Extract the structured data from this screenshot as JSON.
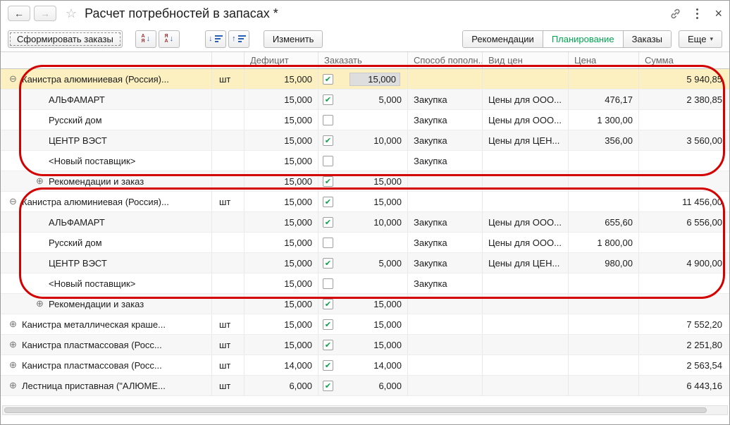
{
  "window": {
    "title": "Расчет потребностей в запасах *"
  },
  "icons": {
    "back": "←",
    "forward": "→",
    "favorite": "☆",
    "menu": "kebab-dots",
    "close": "×",
    "more_arrow": "▾",
    "collapsed": "⊕",
    "expanded": "⊖",
    "check": "✔",
    "sort_arrow_down": "↓",
    "sort_arrow_up": "↑"
  },
  "toolbar": {
    "create_orders": "Сформировать заказы",
    "edit": "Изменить",
    "views": [
      "Рекомендации",
      "Планирование",
      "Заказы"
    ],
    "active_view": "Планирование",
    "more": "Еще"
  },
  "colors": {
    "active_view_green": "#00a651",
    "selected_row_yellow": "#fcf0c0",
    "annotation_red": "#d40000",
    "checkbox_green": "#0ca04a"
  },
  "table": {
    "headers": [
      "",
      "",
      "Дефицит",
      "Заказать",
      "Способ пополн...",
      "Вид цен",
      "Цена",
      "Сумма"
    ],
    "rows": [
      {
        "name": "Канистра алюминиевая (Россия)...",
        "unit": "шт",
        "deficit": "15,000",
        "checked": true,
        "order": "15,000",
        "method": "",
        "price_type": "",
        "price": "",
        "sum": "5 940,85",
        "level": 0,
        "expand": "minus",
        "selected": true
      },
      {
        "name": "АЛЬФАМАРТ",
        "unit": "",
        "deficit": "15,000",
        "checked": true,
        "order": "5,000",
        "method": "Закупка",
        "price_type": "Цены для ООО...",
        "price": "476,17",
        "sum": "2 380,85",
        "level": 1,
        "expand": ""
      },
      {
        "name": "Русский дом",
        "unit": "",
        "deficit": "15,000",
        "checked": false,
        "order": "",
        "method": "Закупка",
        "price_type": "Цены для ООО...",
        "price": "1 300,00",
        "sum": "",
        "level": 1,
        "expand": ""
      },
      {
        "name": "ЦЕНТР ВЭСТ",
        "unit": "",
        "deficit": "15,000",
        "checked": true,
        "order": "10,000",
        "method": "Закупка",
        "price_type": "Цены для ЦЕН...",
        "price": "356,00",
        "sum": "3 560,00",
        "level": 1,
        "expand": ""
      },
      {
        "name": "<Новый поставщик>",
        "unit": "",
        "deficit": "15,000",
        "checked": false,
        "order": "",
        "method": "Закупка",
        "price_type": "",
        "price": "",
        "sum": "",
        "level": 1,
        "expand": ""
      },
      {
        "name": "Рекомендации и заказ",
        "unit": "",
        "deficit": "15,000",
        "checked": true,
        "order": "15,000",
        "method": "",
        "price_type": "",
        "price": "",
        "sum": "",
        "level": 1,
        "expand": "plus"
      },
      {
        "name": "Канистра алюминиевая (Россия)...",
        "unit": "шт",
        "deficit": "15,000",
        "checked": true,
        "order": "15,000",
        "method": "",
        "price_type": "",
        "price": "",
        "sum": "11 456,00",
        "level": 0,
        "expand": "minus"
      },
      {
        "name": "АЛЬФАМАРТ",
        "unit": "",
        "deficit": "15,000",
        "checked": true,
        "order": "10,000",
        "method": "Закупка",
        "price_type": "Цены для ООО...",
        "price": "655,60",
        "sum": "6 556,00",
        "level": 1,
        "expand": ""
      },
      {
        "name": "Русский дом",
        "unit": "",
        "deficit": "15,000",
        "checked": false,
        "order": "",
        "method": "Закупка",
        "price_type": "Цены для ООО...",
        "price": "1 800,00",
        "sum": "",
        "level": 1,
        "expand": ""
      },
      {
        "name": "ЦЕНТР ВЭСТ",
        "unit": "",
        "deficit": "15,000",
        "checked": true,
        "order": "5,000",
        "method": "Закупка",
        "price_type": "Цены для ЦЕН...",
        "price": "980,00",
        "sum": "4 900,00",
        "level": 1,
        "expand": ""
      },
      {
        "name": "<Новый поставщик>",
        "unit": "",
        "deficit": "15,000",
        "checked": false,
        "order": "",
        "method": "Закупка",
        "price_type": "",
        "price": "",
        "sum": "",
        "level": 1,
        "expand": ""
      },
      {
        "name": "Рекомендации и заказ",
        "unit": "",
        "deficit": "15,000",
        "checked": true,
        "order": "15,000",
        "method": "",
        "price_type": "",
        "price": "",
        "sum": "",
        "level": 1,
        "expand": "plus"
      },
      {
        "name": "Канистра металлическая краше...",
        "unit": "шт",
        "deficit": "15,000",
        "checked": true,
        "order": "15,000",
        "method": "",
        "price_type": "",
        "price": "",
        "sum": "7 552,20",
        "level": 0,
        "expand": "plus"
      },
      {
        "name": "Канистра пластмассовая (Росс...",
        "unit": "шт",
        "deficit": "15,000",
        "checked": true,
        "order": "15,000",
        "method": "",
        "price_type": "",
        "price": "",
        "sum": "2 251,80",
        "level": 0,
        "expand": "plus"
      },
      {
        "name": "Канистра пластмассовая (Росс...",
        "unit": "шт",
        "deficit": "14,000",
        "checked": true,
        "order": "14,000",
        "method": "",
        "price_type": "",
        "price": "",
        "sum": "2 563,54",
        "level": 0,
        "expand": "plus"
      },
      {
        "name": "Лестница приставная (\"АЛЮМЕ...",
        "unit": "шт",
        "deficit": "6,000",
        "checked": true,
        "order": "6,000",
        "method": "",
        "price_type": "",
        "price": "",
        "sum": "6 443,16",
        "level": 0,
        "expand": "plus"
      }
    ]
  }
}
